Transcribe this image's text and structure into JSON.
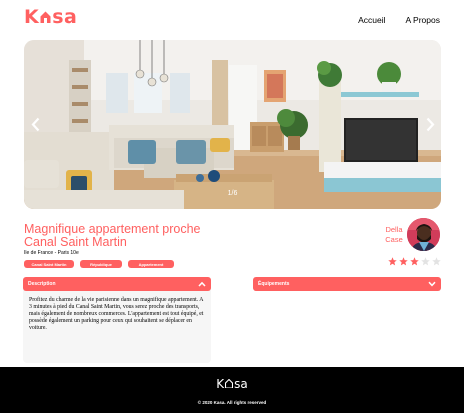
{
  "header": {
    "logo_first": "K",
    "logo_rest": "sa",
    "nav": [
      {
        "label": "Accueil"
      },
      {
        "label": "A Propos"
      }
    ]
  },
  "carousel": {
    "counter": "1/6",
    "prev_icon": "chevron-left-icon",
    "next_icon": "chevron-right-icon"
  },
  "listing": {
    "title": "Magnifique appartement proche Canal Saint Martin",
    "location": "Ile de France - Paris 10e",
    "tags": [
      {
        "label": "Canal Saint Martin"
      },
      {
        "label": "République"
      },
      {
        "label": "Appartement"
      }
    ],
    "rating": 3,
    "rating_max": 5
  },
  "host": {
    "first_name": "Della",
    "last_name": "Case"
  },
  "collapses": {
    "description": {
      "label": "Description",
      "icon": "chevron-up-icon",
      "text": "Profitez du charme de la vie parisienne dans un magnifique appartement. A 3 minutes à pied du Canal Saint Martin, vous serez proche des transports, mais également de nombreux commerces. L'appartement est tout équipé, et possède également un parking pour ceux qui souhaitent se déplacer en voiture."
    },
    "equipements": {
      "label": "Équipements",
      "icon": "chevron-down-icon"
    }
  },
  "footer": {
    "logo_first": "K",
    "logo_rest": "sa",
    "copyright": "© 2020 Kasa. All rights reserved"
  },
  "colors": {
    "accent": "#FF6060",
    "star_off": "#E3E3E3",
    "footer_bg": "#000000"
  }
}
